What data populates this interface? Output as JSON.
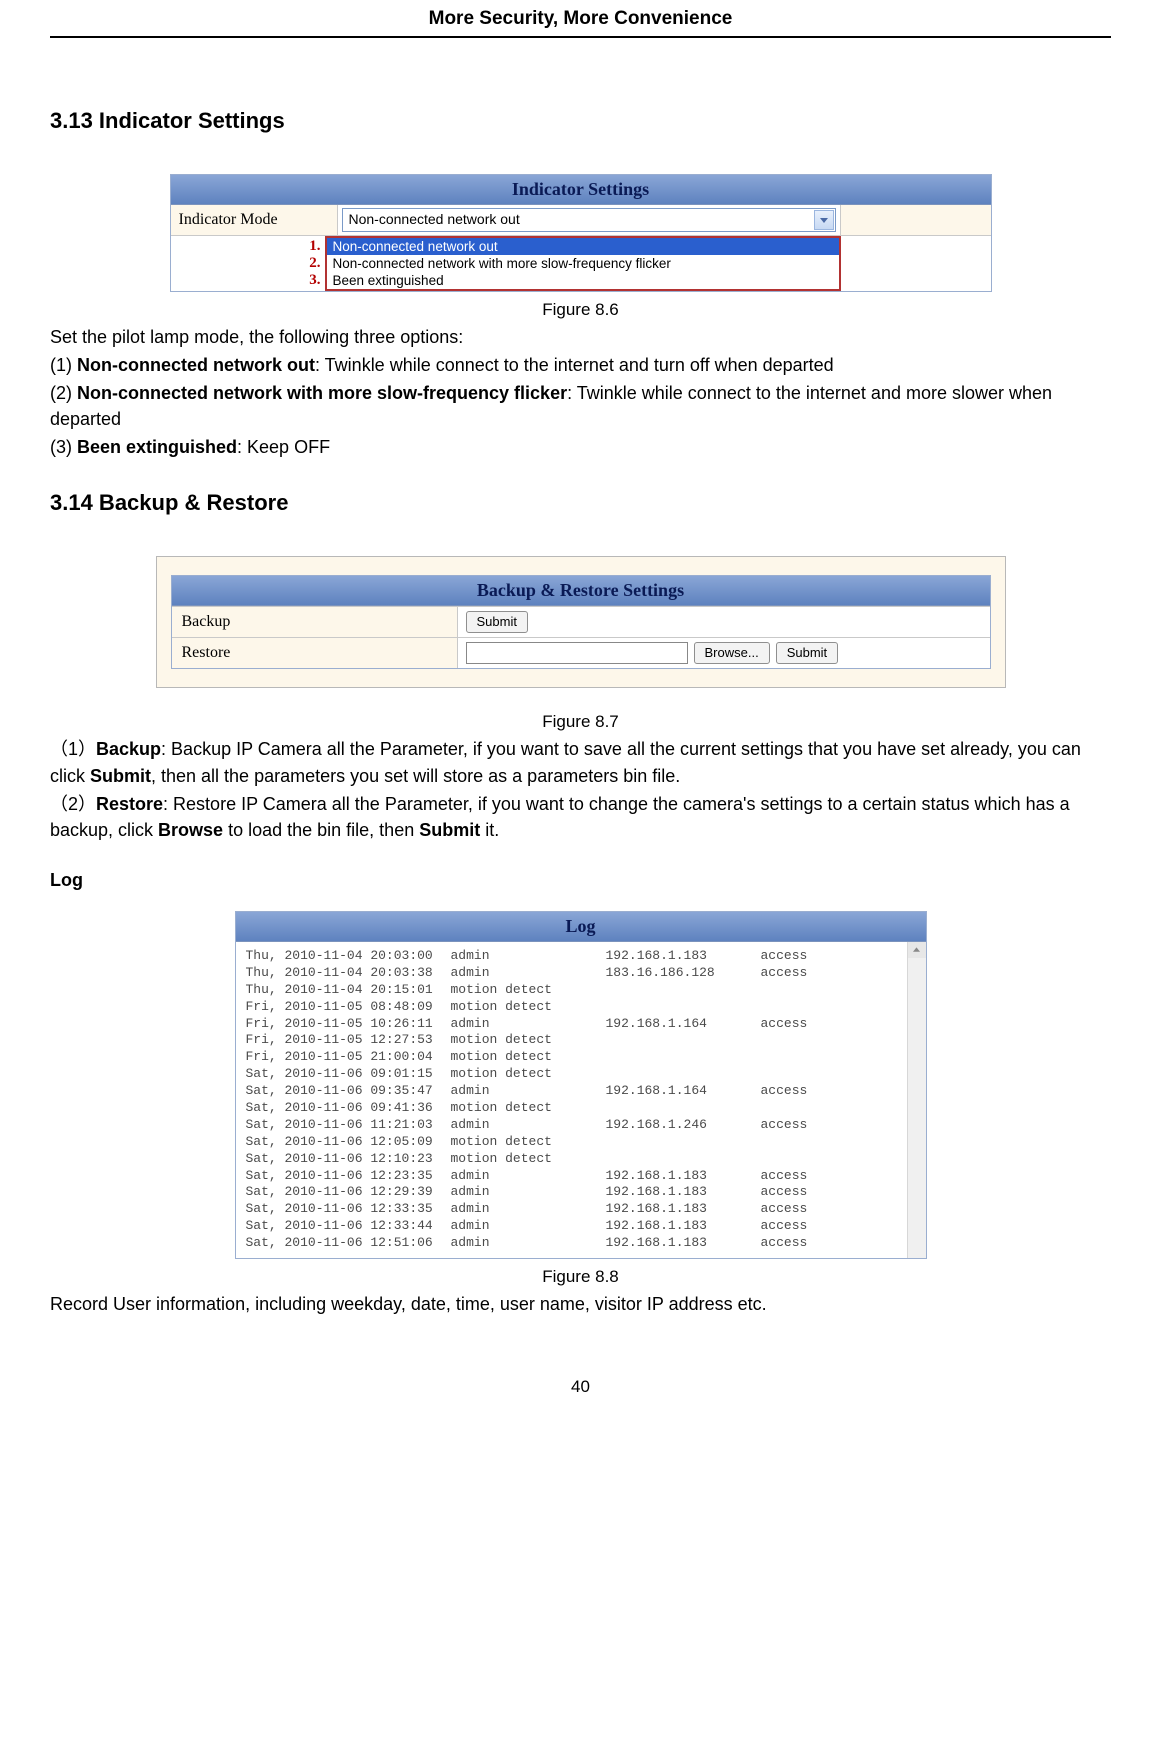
{
  "header": {
    "title": "More Security, More Convenience"
  },
  "page_number": "40",
  "section313": {
    "heading": "3.13 Indicator Settings",
    "panel_title": "Indicator Settings",
    "label": "Indicator Mode",
    "selected": "Non-connected network out",
    "options": [
      "Non-connected network out",
      "Non-connected network with more slow-frequency flicker",
      "Been extinguished"
    ],
    "nums": [
      "1.",
      "2.",
      "3."
    ],
    "caption": "Figure 8.6",
    "intro": "Set the pilot lamp mode, the following three options:",
    "item1a": "(1) ",
    "item1b": "Non-connected network out",
    "item1c": ": Twinkle while connect to the internet and turn off when departed",
    "item2a": "(2) ",
    "item2b": "Non-connected network with more slow-frequency flicker",
    "item2c": ": Twinkle while connect to the internet and more slower when departed",
    "item3a": "(3) ",
    "item3b": "Been extinguished",
    "item3c": ": Keep OFF"
  },
  "section314": {
    "heading": "3.14 Backup & Restore",
    "panel_title": "Backup & Restore Settings",
    "backup_label": "Backup",
    "restore_label": "Restore",
    "submit": "Submit",
    "browse": "Browse...",
    "caption": "Figure 8.7",
    "p1a": "（1）",
    "p1b": "Backup",
    "p1c": ": Backup IP Camera all the Parameter, if you want to save all the current settings that you have set already, you can click ",
    "p1d": "Submit",
    "p1e": ", then all the parameters you set will store as a parameters bin file.",
    "p2a": "（2）",
    "p2b": "Restore",
    "p2c": ": Restore IP Camera all the Parameter, if you want to change the camera's settings to a certain status which has a backup, click ",
    "p2d": "Browse",
    "p2e": " to load the bin file, then ",
    "p2f": "Submit",
    "p2g": " it."
  },
  "log": {
    "heading": "Log",
    "panel_title": "Log",
    "caption": "Figure 8.8",
    "summary": "Record User information, including weekday, date, time, user name, visitor IP address etc.",
    "rows": [
      {
        "date": "Thu, 2010-11-04 20:03:00",
        "user": "admin",
        "ip": "192.168.1.183",
        "act": "access"
      },
      {
        "date": "Thu, 2010-11-04 20:03:38",
        "user": "admin",
        "ip": "183.16.186.128",
        "act": "access"
      },
      {
        "date": "Thu, 2010-11-04 20:15:01",
        "user": "motion detect",
        "ip": "",
        "act": ""
      },
      {
        "date": "Fri, 2010-11-05 08:48:09",
        "user": "motion detect",
        "ip": "",
        "act": ""
      },
      {
        "date": "Fri, 2010-11-05 10:26:11",
        "user": "admin",
        "ip": "192.168.1.164",
        "act": "access"
      },
      {
        "date": "Fri, 2010-11-05 12:27:53",
        "user": "motion detect",
        "ip": "",
        "act": ""
      },
      {
        "date": "Fri, 2010-11-05 21:00:04",
        "user": "motion detect",
        "ip": "",
        "act": ""
      },
      {
        "date": "Sat, 2010-11-06 09:01:15",
        "user": "motion detect",
        "ip": "",
        "act": ""
      },
      {
        "date": "Sat, 2010-11-06 09:35:47",
        "user": "admin",
        "ip": "192.168.1.164",
        "act": "access"
      },
      {
        "date": "Sat, 2010-11-06 09:41:36",
        "user": "motion detect",
        "ip": "",
        "act": ""
      },
      {
        "date": "Sat, 2010-11-06 11:21:03",
        "user": "admin",
        "ip": "192.168.1.246",
        "act": "access"
      },
      {
        "date": "Sat, 2010-11-06 12:05:09",
        "user": "motion detect",
        "ip": "",
        "act": ""
      },
      {
        "date": "Sat, 2010-11-06 12:10:23",
        "user": "motion detect",
        "ip": "",
        "act": ""
      },
      {
        "date": "Sat, 2010-11-06 12:23:35",
        "user": "admin",
        "ip": "192.168.1.183",
        "act": "access"
      },
      {
        "date": "Sat, 2010-11-06 12:29:39",
        "user": "admin",
        "ip": "192.168.1.183",
        "act": "access"
      },
      {
        "date": "Sat, 2010-11-06 12:33:35",
        "user": "admin",
        "ip": "192.168.1.183",
        "act": "access"
      },
      {
        "date": "Sat, 2010-11-06 12:33:44",
        "user": "admin",
        "ip": "192.168.1.183",
        "act": "access"
      },
      {
        "date": "Sat, 2010-11-06 12:51:06",
        "user": "admin",
        "ip": "192.168.1.183",
        "act": "access"
      }
    ]
  }
}
